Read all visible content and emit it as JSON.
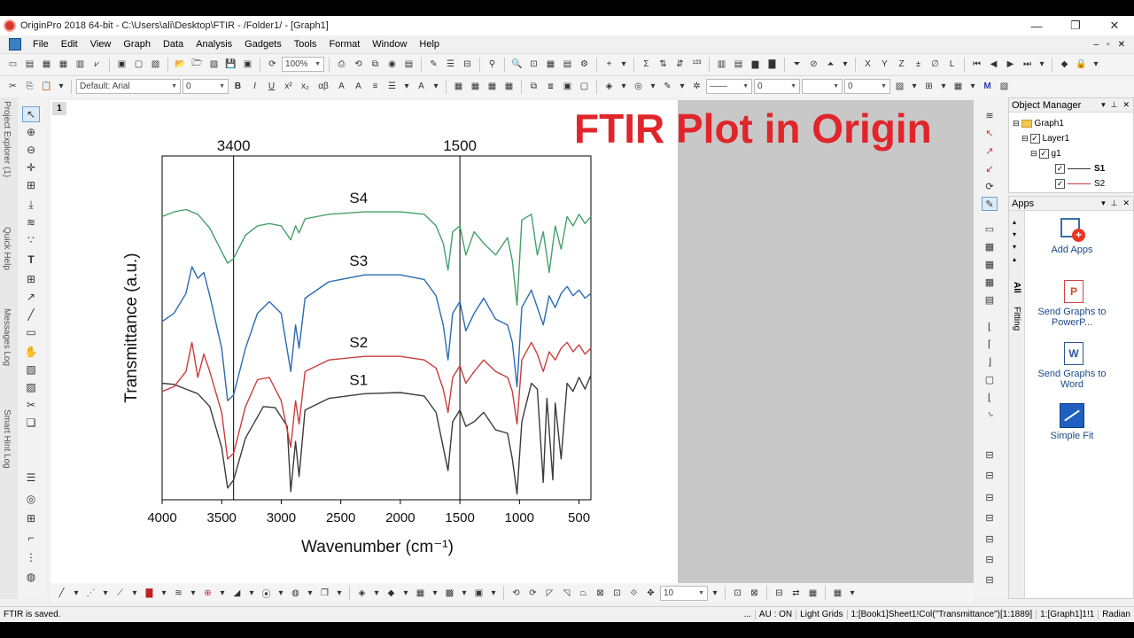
{
  "window": {
    "title": "OriginPro 2018 64-bit - C:\\Users\\ali\\Desktop\\FTIR - /Folder1/ - [Graph1]",
    "minimize": "—",
    "restore": "❐",
    "close": "✕"
  },
  "menu": {
    "items": [
      "File",
      "Edit",
      "View",
      "Graph",
      "Data",
      "Analysis",
      "Gadgets",
      "Tools",
      "Format",
      "Window",
      "Help"
    ],
    "mdi_min": "–",
    "mdi_restore": "▫",
    "mdi_close": "✕"
  },
  "toolbar1": {
    "zoom": "100%"
  },
  "toolbar2": {
    "font_name": "Default: Arial",
    "font_size": "0",
    "bold": "B",
    "italic": "I",
    "underline": "U",
    "superscript": "x²",
    "subscript": "x₂",
    "greek": "αβ",
    "line_width_value": "0",
    "pattern_value": "0"
  },
  "side_tabs": [
    "Project Explorer (1)",
    "Quick Help",
    "Messages Log",
    "Smart Hint Log"
  ],
  "graph": {
    "page_number": "1",
    "title": "FTIR Plot in Origin",
    "ref_line_labels": [
      "3400",
      "1500"
    ]
  },
  "chart_data": {
    "type": "line",
    "title": "FTIR Plot in Origin",
    "xlabel": "Wavenumber (cm⁻¹)",
    "ylabel": "Transmittance (a.u.)",
    "xlim": [
      4000,
      400
    ],
    "x_ticks": [
      "4000",
      "3500",
      "3000",
      "2500",
      "2000",
      "1500",
      "1000",
      "500"
    ],
    "reference_lines": [
      3400,
      1500
    ],
    "series": [
      {
        "name": "S1",
        "color": "#3b3b3b",
        "points": [
          [
            4000,
            0.95
          ],
          [
            3900,
            0.94
          ],
          [
            3800,
            0.9
          ],
          [
            3700,
            0.86
          ],
          [
            3600,
            0.75
          ],
          [
            3500,
            0.4
          ],
          [
            3450,
            0.05
          ],
          [
            3400,
            0.12
          ],
          [
            3300,
            0.48
          ],
          [
            3150,
            0.75
          ],
          [
            3050,
            0.74
          ],
          [
            2950,
            0.58
          ],
          [
            2920,
            0.02
          ],
          [
            2880,
            0.45
          ],
          [
            2850,
            0.15
          ],
          [
            2800,
            0.72
          ],
          [
            2600,
            0.82
          ],
          [
            2300,
            0.86
          ],
          [
            2000,
            0.87
          ],
          [
            1800,
            0.84
          ],
          [
            1700,
            0.7
          ],
          [
            1640,
            0.4
          ],
          [
            1600,
            0.2
          ],
          [
            1560,
            0.62
          ],
          [
            1500,
            0.72
          ],
          [
            1450,
            0.58
          ],
          [
            1380,
            0.62
          ],
          [
            1300,
            0.7
          ],
          [
            1200,
            0.55
          ],
          [
            1100,
            0.52
          ],
          [
            1060,
            0.3
          ],
          [
            1020,
            0.0
          ],
          [
            980,
            0.62
          ],
          [
            900,
            0.95
          ],
          [
            850,
            0.9
          ],
          [
            800,
            0.1
          ],
          [
            770,
            0.82
          ],
          [
            720,
            0.12
          ],
          [
            700,
            0.78
          ],
          [
            650,
            0.3
          ],
          [
            600,
            0.95
          ],
          [
            550,
            0.88
          ],
          [
            500,
            1.0
          ],
          [
            450,
            0.9
          ],
          [
            400,
            1.02
          ]
        ]
      },
      {
        "name": "S2",
        "color": "#cc3d3d",
        "points": [
          [
            4000,
            0.88
          ],
          [
            3900,
            0.92
          ],
          [
            3800,
            1.05
          ],
          [
            3750,
            1.3
          ],
          [
            3700,
            1.0
          ],
          [
            3650,
            1.2
          ],
          [
            3600,
            1.05
          ],
          [
            3500,
            0.7
          ],
          [
            3450,
            0.3
          ],
          [
            3400,
            0.35
          ],
          [
            3300,
            0.75
          ],
          [
            3200,
            0.98
          ],
          [
            3100,
            1.0
          ],
          [
            3000,
            0.8
          ],
          [
            2920,
            0.4
          ],
          [
            2880,
            0.8
          ],
          [
            2850,
            0.6
          ],
          [
            2800,
            1.05
          ],
          [
            2600,
            1.15
          ],
          [
            2300,
            1.18
          ],
          [
            2000,
            1.18
          ],
          [
            1800,
            1.15
          ],
          [
            1700,
            1.08
          ],
          [
            1640,
            0.9
          ],
          [
            1600,
            0.7
          ],
          [
            1560,
            1.0
          ],
          [
            1500,
            1.1
          ],
          [
            1450,
            0.95
          ],
          [
            1380,
            1.05
          ],
          [
            1300,
            1.15
          ],
          [
            1200,
            1.05
          ],
          [
            1100,
            1.0
          ],
          [
            1060,
            0.88
          ],
          [
            1020,
            0.6
          ],
          [
            980,
            1.15
          ],
          [
            900,
            1.3
          ],
          [
            850,
            1.2
          ],
          [
            800,
            1.05
          ],
          [
            750,
            1.22
          ],
          [
            700,
            1.15
          ],
          [
            650,
            1.25
          ],
          [
            600,
            1.3
          ],
          [
            550,
            1.22
          ],
          [
            500,
            1.28
          ],
          [
            450,
            1.2
          ],
          [
            400,
            1.25
          ]
        ]
      },
      {
        "name": "S3",
        "color": "#2b6cb0",
        "points": [
          [
            4000,
            1.48
          ],
          [
            3900,
            1.55
          ],
          [
            3800,
            1.72
          ],
          [
            3750,
            1.95
          ],
          [
            3700,
            1.85
          ],
          [
            3650,
            1.9
          ],
          [
            3600,
            1.7
          ],
          [
            3500,
            1.25
          ],
          [
            3450,
            0.8
          ],
          [
            3400,
            0.85
          ],
          [
            3300,
            1.25
          ],
          [
            3200,
            1.55
          ],
          [
            3100,
            1.65
          ],
          [
            3000,
            1.55
          ],
          [
            2920,
            1.05
          ],
          [
            2880,
            1.45
          ],
          [
            2850,
            1.25
          ],
          [
            2800,
            1.68
          ],
          [
            2600,
            1.82
          ],
          [
            2300,
            1.88
          ],
          [
            2000,
            1.88
          ],
          [
            1800,
            1.84
          ],
          [
            1700,
            1.7
          ],
          [
            1640,
            1.45
          ],
          [
            1600,
            1.15
          ],
          [
            1560,
            1.55
          ],
          [
            1500,
            1.65
          ],
          [
            1450,
            1.4
          ],
          [
            1380,
            1.55
          ],
          [
            1300,
            1.68
          ],
          [
            1200,
            1.5
          ],
          [
            1100,
            1.45
          ],
          [
            1060,
            1.3
          ],
          [
            1020,
            0.92
          ],
          [
            980,
            1.6
          ],
          [
            900,
            1.75
          ],
          [
            850,
            1.6
          ],
          [
            800,
            1.45
          ],
          [
            750,
            1.7
          ],
          [
            700,
            1.6
          ],
          [
            650,
            1.72
          ],
          [
            600,
            1.78
          ],
          [
            550,
            1.7
          ],
          [
            500,
            1.75
          ],
          [
            450,
            1.68
          ],
          [
            400,
            1.72
          ]
        ]
      },
      {
        "name": "S4",
        "color": "#45a06a",
        "points": [
          [
            4000,
            2.38
          ],
          [
            3900,
            2.42
          ],
          [
            3800,
            2.44
          ],
          [
            3700,
            2.4
          ],
          [
            3600,
            2.28
          ],
          [
            3500,
            2.08
          ],
          [
            3450,
            1.98
          ],
          [
            3400,
            2.02
          ],
          [
            3300,
            2.22
          ],
          [
            3200,
            2.3
          ],
          [
            3100,
            2.32
          ],
          [
            3000,
            2.3
          ],
          [
            2920,
            2.18
          ],
          [
            2880,
            2.3
          ],
          [
            2850,
            2.24
          ],
          [
            2800,
            2.36
          ],
          [
            2600,
            2.4
          ],
          [
            2300,
            2.42
          ],
          [
            2000,
            2.42
          ],
          [
            1800,
            2.4
          ],
          [
            1700,
            2.3
          ],
          [
            1640,
            2.15
          ],
          [
            1600,
            1.92
          ],
          [
            1560,
            2.25
          ],
          [
            1500,
            2.3
          ],
          [
            1450,
            2.05
          ],
          [
            1380,
            2.25
          ],
          [
            1300,
            2.15
          ],
          [
            1200,
            2.05
          ],
          [
            1100,
            2.2
          ],
          [
            1060,
            2.0
          ],
          [
            1020,
            1.62
          ],
          [
            980,
            2.35
          ],
          [
            900,
            2.4
          ],
          [
            850,
            2.05
          ],
          [
            800,
            2.25
          ],
          [
            750,
            1.9
          ],
          [
            700,
            2.3
          ],
          [
            650,
            2.1
          ],
          [
            600,
            2.38
          ],
          [
            550,
            2.3
          ],
          [
            500,
            2.4
          ],
          [
            450,
            2.32
          ],
          [
            400,
            2.38
          ]
        ]
      }
    ]
  },
  "object_manager": {
    "title": "Object Manager",
    "graph": "Graph1",
    "layer": "Layer1",
    "group": "g1",
    "s1": "S1",
    "s2": "S2"
  },
  "apps": {
    "title": "Apps",
    "side_all": "All",
    "side_fitting": "Fitting",
    "items": [
      {
        "label": "Add Apps"
      },
      {
        "label": "Send Graphs to PowerP..."
      },
      {
        "label": "Send Graphs to Word"
      },
      {
        "label": "Simple Fit"
      }
    ]
  },
  "bottom_toolbar": {
    "size_value": "10"
  },
  "status": {
    "message": "FTIR is saved.",
    "ellipsis": "...",
    "au": "AU : ON",
    "grids": "Light Grids",
    "column": "1:[Book1]Sheet1!Col(\"Transmittance\")[1:1889]",
    "graph": "1:[Graph1]1!1",
    "angle": "Radian"
  },
  "colors": {
    "title_red": "#e0252b",
    "s1": "#3b3b3b",
    "s2": "#cc3d3d",
    "s3": "#2b6cb0",
    "s4": "#45a06a"
  }
}
